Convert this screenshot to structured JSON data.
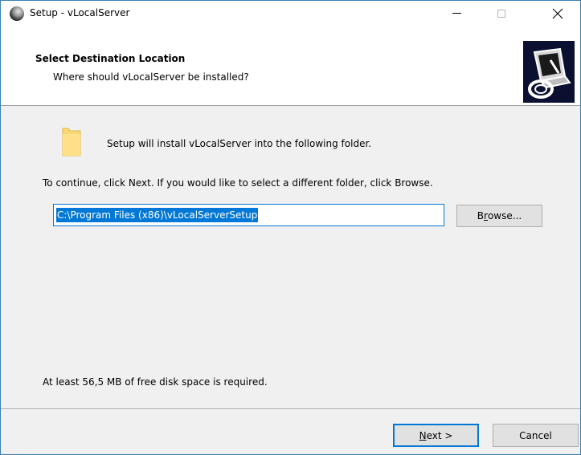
{
  "window": {
    "title": "Setup - vLocalServer"
  },
  "titlebar": {
    "min_symbol": "",
    "close_symbol": "✕"
  },
  "header": {
    "title": "Select Destination Location",
    "subtitle": "Where should vLocalServer be installed?"
  },
  "body": {
    "intro": "Setup will install vLocalServer into the following folder.",
    "continue": "To continue, click Next. If you would like to select a different folder, click Browse.",
    "path_value": "C:\\Program Files (x86)\\vLocalServerSetup",
    "browse_prefix": "B",
    "browse_accel": "r",
    "browse_suffix": "owse...",
    "disk_space": "At least 56,5 MB of free disk space is required."
  },
  "footer": {
    "next_accel": "N",
    "next_suffix": "ext >",
    "cancel_label": "Cancel"
  },
  "colors": {
    "accent": "#0078d7",
    "folder": "#f8d775",
    "header_image_bg": "#0b1030"
  },
  "icons": {
    "app": "globe-icon",
    "folder": "folder-icon",
    "wizard": "computer-install-icon"
  }
}
